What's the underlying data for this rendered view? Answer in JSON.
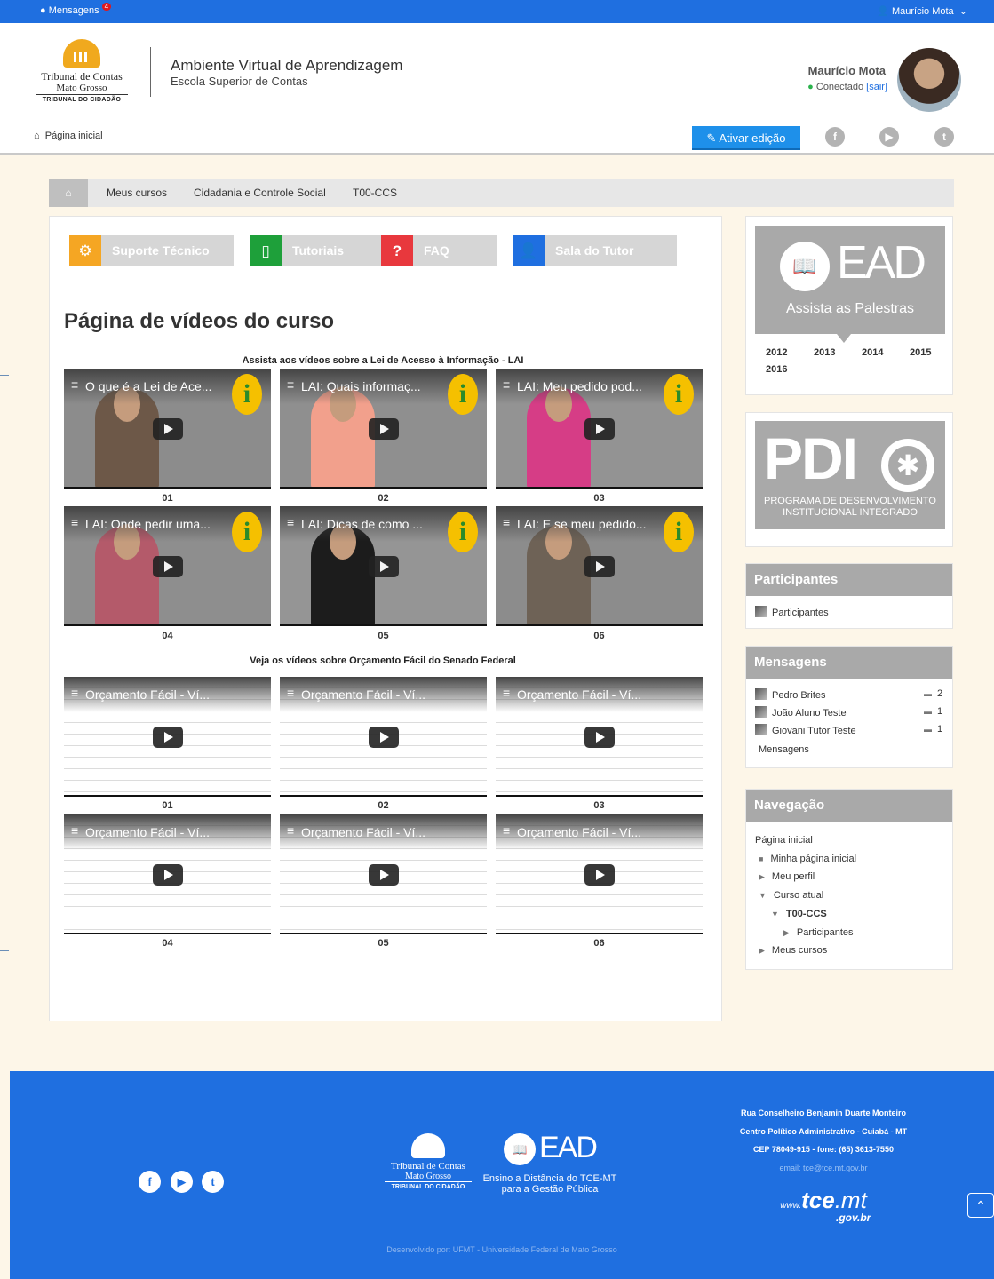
{
  "topbar": {
    "messages_label": "Mensagens",
    "messages_count": "4",
    "user_label": "Maurício Mota"
  },
  "header": {
    "logo": {
      "line1": "Tribunal de Contas",
      "line2": "Mato Grosso",
      "line3": "TRIBUNAL DO CIDADÃO"
    },
    "title": "Ambiente Virtual de Aprendizagem",
    "subtitle": "Escola Superior de Contas",
    "user_name": "Maurício Mota",
    "status": "Conectado",
    "logout": "[sair]",
    "home_link": "Página inicial",
    "edit_button": "Ativar edição"
  },
  "breadcrumb": [
    "Meus cursos",
    "Cidadania e Controle Social",
    "T00-CCS"
  ],
  "quick_buttons": [
    {
      "label": "Suporte Técnico",
      "icon": "gear-icon",
      "color": "#f5a623"
    },
    {
      "label": "Tutoriais",
      "icon": "document-icon",
      "color": "#1ea03a"
    },
    {
      "label": "FAQ",
      "icon": "question-icon",
      "color": "#e8383d"
    },
    {
      "label": "Sala do Tutor",
      "icon": "user-icon",
      "color": "#1f6fe0"
    }
  ],
  "page_title": "Página de vídeos do curso",
  "section1": {
    "caption": "Assista aos vídeos sobre a Lei de Acesso à Informação - LAI",
    "videos": [
      {
        "title": "O que é a Lei de Ace...",
        "label": "01"
      },
      {
        "title": "LAI: Quais informaç...",
        "label": "02"
      },
      {
        "title": "LAI: Meu pedido pod...",
        "label": "03"
      },
      {
        "title": "LAI: Onde pedir uma...",
        "label": "04"
      },
      {
        "title": "LAI: Dicas de como ...",
        "label": "05"
      },
      {
        "title": "LAI: E se meu pedido...",
        "label": "06"
      }
    ]
  },
  "section2": {
    "caption": "Veja os vídeos sobre Orçamento Fácil do Senado Federal",
    "videos": [
      {
        "title": "Orçamento Fácil - Ví...",
        "label": "01"
      },
      {
        "title": "Orçamento Fácil - Ví...",
        "label": "02"
      },
      {
        "title": "Orçamento Fácil - Ví...",
        "label": "03"
      },
      {
        "title": "Orçamento Fácil - Ví...",
        "label": "04"
      },
      {
        "title": "Orçamento Fácil - Ví...",
        "label": "05"
      },
      {
        "title": "Orçamento Fácil - Ví...",
        "label": "06"
      }
    ]
  },
  "ead_block": {
    "logo_text": "EAD",
    "subtitle": "Assista as Palestras",
    "years": [
      "2012",
      "2013",
      "2014",
      "2015",
      "2016"
    ]
  },
  "pdi_block": {
    "logo_text": "PDI",
    "subtitle_line1": "PROGRAMA DE DESENVOLVIMENTO",
    "subtitle_line2": "INSTITUCIONAL INTEGRADO"
  },
  "participants_block": {
    "title": "Participantes",
    "link": "Participantes"
  },
  "messages_block": {
    "title": "Mensagens",
    "items": [
      {
        "name": "Pedro Brites",
        "count": "2"
      },
      {
        "name": "João Aluno Teste",
        "count": "1"
      },
      {
        "name": "Giovani Tutor Teste",
        "count": "1"
      }
    ],
    "link": "Mensagens"
  },
  "navigation_block": {
    "title": "Navegação",
    "home": "Página inicial",
    "my_home": "Minha página inicial",
    "profile": "Meu perfil",
    "current_course": "Curso atual",
    "course": "T00-CCS",
    "participants": "Participantes",
    "my_courses": "Meus cursos"
  },
  "footer": {
    "logo": {
      "line1": "Tribunal de Contas",
      "line2": "Mato Grosso",
      "line3": "TRIBUNAL DO CIDADÃO"
    },
    "ead_text": "EAD",
    "ead_sub1": "Ensino a Distância do TCE-MT",
    "ead_sub2": "para a Gestão Pública",
    "address1": "Rua Conselheiro Benjamin Duarte Monteiro",
    "address2": "Centro Político Administrativo - Cuiabá - MT",
    "address3": "CEP 78049-915 - fone: (65) 3613-7550",
    "email": "email: tce@tce.mt.gov.br",
    "web_prefix": "www.",
    "web_domain": "tce",
    "web_tld": ".mt",
    "web_suffix": ".gov.br",
    "developer": "Desenvolvido por: UFMT - Universidade Federal de Mato Grosso"
  }
}
